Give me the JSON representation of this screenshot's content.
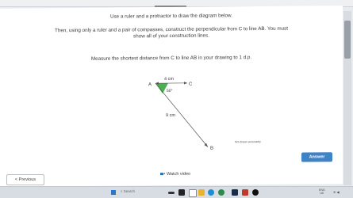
{
  "question": {
    "line1": "Use a ruler and a protractor to draw the diagram below.",
    "line2": "Then, using only a ruler and a pair of compasses, construct the perpendicular from C to line AB. You must",
    "line3": "show all of your construction lines.",
    "line4": "Measure the shortest distance from C to line AB in your drawing to 1 d.p."
  },
  "diagram": {
    "point_a": "A",
    "point_b": "B",
    "point_c": "C",
    "label_ac": "4 cm",
    "label_ab": "9 cm",
    "label_angle": "50°",
    "angle_color": "#4caf50",
    "note": "Not drawn accurately"
  },
  "buttons": {
    "answer": "Answer",
    "watch_video": "Watch video",
    "previous": "< Previous"
  },
  "taskbar": {
    "search_placeholder": "Search",
    "tray_top": "ENG",
    "tray_bottom": "UK"
  },
  "colors": {
    "accent": "#3f83c7",
    "angle_fill": "#4caf50"
  }
}
